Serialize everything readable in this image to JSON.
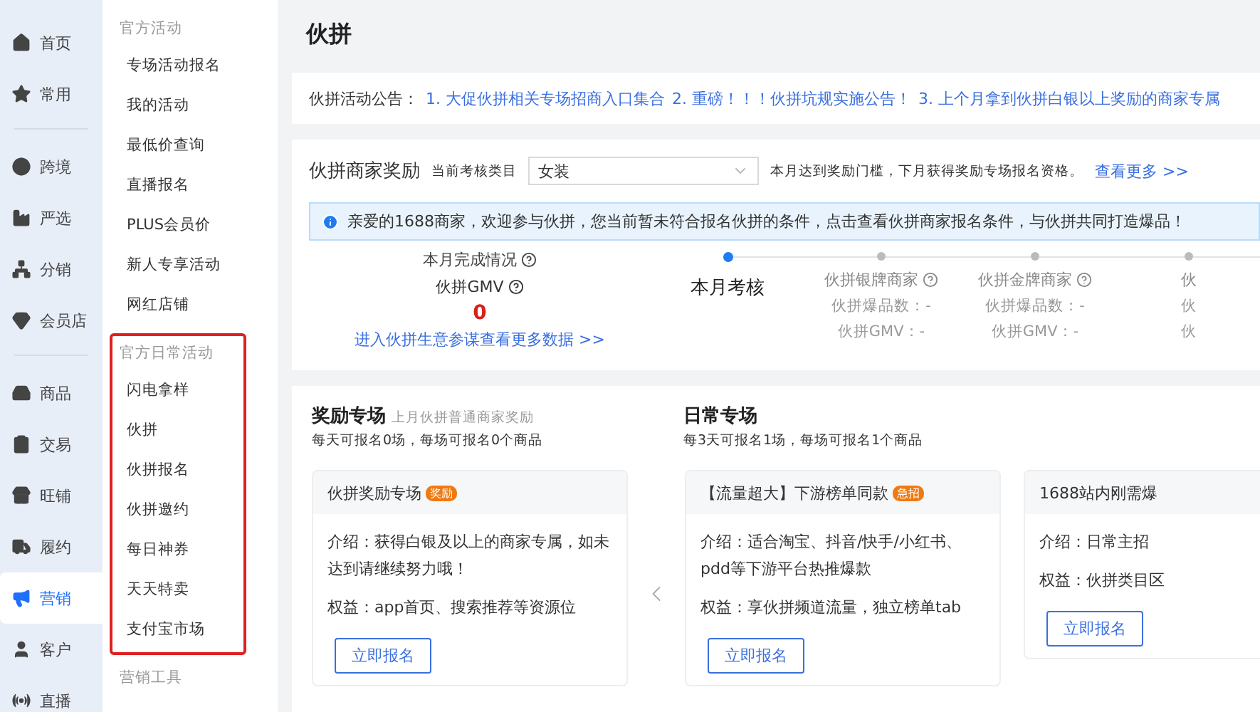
{
  "nav_groups": [
    [
      {
        "label": "首页",
        "selected": false
      },
      {
        "label": "常用",
        "selected": false
      }
    ],
    [
      {
        "label": "跨境",
        "selected": false
      },
      {
        "label": "严选",
        "selected": false
      },
      {
        "label": "分销",
        "selected": false
      },
      {
        "label": "会员店",
        "selected": false
      }
    ],
    [
      {
        "label": "商品",
        "selected": false
      },
      {
        "label": "交易",
        "selected": false
      },
      {
        "label": "旺铺",
        "selected": false
      },
      {
        "label": "履约",
        "selected": false
      },
      {
        "label": "营销",
        "selected": true
      },
      {
        "label": "客户",
        "selected": false
      },
      {
        "label": "直播",
        "selected": false
      }
    ]
  ],
  "submenu": [
    {
      "title": "官方活动",
      "kind": "plain",
      "items": [
        "专场活动报名",
        "我的活动",
        "最低价查询",
        "直播报名",
        "PLUS会员价",
        "新人专享活动",
        "网红店铺"
      ]
    },
    {
      "title": "官方日常活动",
      "kind": "highlighted",
      "items": [
        "闪电拿样",
        "伙拼",
        "伙拼报名",
        "伙拼邀约",
        "每日神券",
        "天天特卖",
        "支付宝市场"
      ]
    },
    {
      "title": "营销工具",
      "kind": "plain"
    }
  ],
  "page_title": "伙拼",
  "announcement": {
    "label": "伙拼活动公告：",
    "links": [
      "1. 大促伙拼相关专场招商入口集合",
      "2. 重磅！！！伙拼坑规实施公告！",
      "3. 上个月拿到伙拼白银以上奖励的商家专属"
    ]
  },
  "reward": {
    "title": "伙拼商家奖励",
    "category_label": "当前考核类目",
    "category_value": "女装",
    "note": "本月达到奖励门槛，下月获得奖励专场报名资格。",
    "more_link": "查看更多 >>",
    "info": "亲爱的1688商家，欢迎参与伙拼，您当前暂未符合报名伙拼的条件，点击查看伙拼商家报名条件，与伙拼共同打造爆品！"
  },
  "stats": {
    "progress_label": "本月完成情况",
    "gmv_label": "伙拼GMV",
    "gmv_value": "0",
    "link": "进入伙拼生意参谋查看更多数据 >>"
  },
  "steps": [
    {
      "title": "本月考核",
      "selected": true
    },
    {
      "title": "伙拼银牌商家",
      "selected": false,
      "lines": [
        "伙拼爆品数：-",
        "伙拼GMV：-"
      ]
    },
    {
      "title": "伙拼金牌商家",
      "selected": false,
      "lines": [
        "伙拼爆品数：-",
        "伙拼GMV：-"
      ]
    },
    {
      "title": "伙",
      "selected": false,
      "lines": [
        "伙",
        "伙"
      ]
    }
  ],
  "zones": [
    {
      "title": "奖励专场",
      "subtitle": "上月伙拼普通商家奖励",
      "desc": "每天可报名0场，每场可报名0个商品"
    },
    {
      "title": "日常专场",
      "desc": "每3天可报名1场，每场可报名1个商品"
    }
  ],
  "cards": [
    {
      "title": "伙拼奖励专场",
      "tag": "奖励",
      "intro": "介绍：获得白银及以上的商家专属，如未达到请继续努力哦！",
      "benefit": "权益：app首页、搜索推荐等资源位",
      "button": "立即报名"
    },
    {
      "title": "【流量超大】下游榜单同款",
      "tag": "急招",
      "intro": "介绍：适合淘宝、抖音/快手/小红书、pdd等下游平台热推爆款",
      "benefit": "权益：享伙拼频道流量，独立榜单tab",
      "button": "立即报名"
    },
    {
      "title": "1688站内刚需爆",
      "intro": "介绍：日常主招",
      "benefit": "权益：伙拼类目区",
      "button": "立即报名"
    }
  ]
}
